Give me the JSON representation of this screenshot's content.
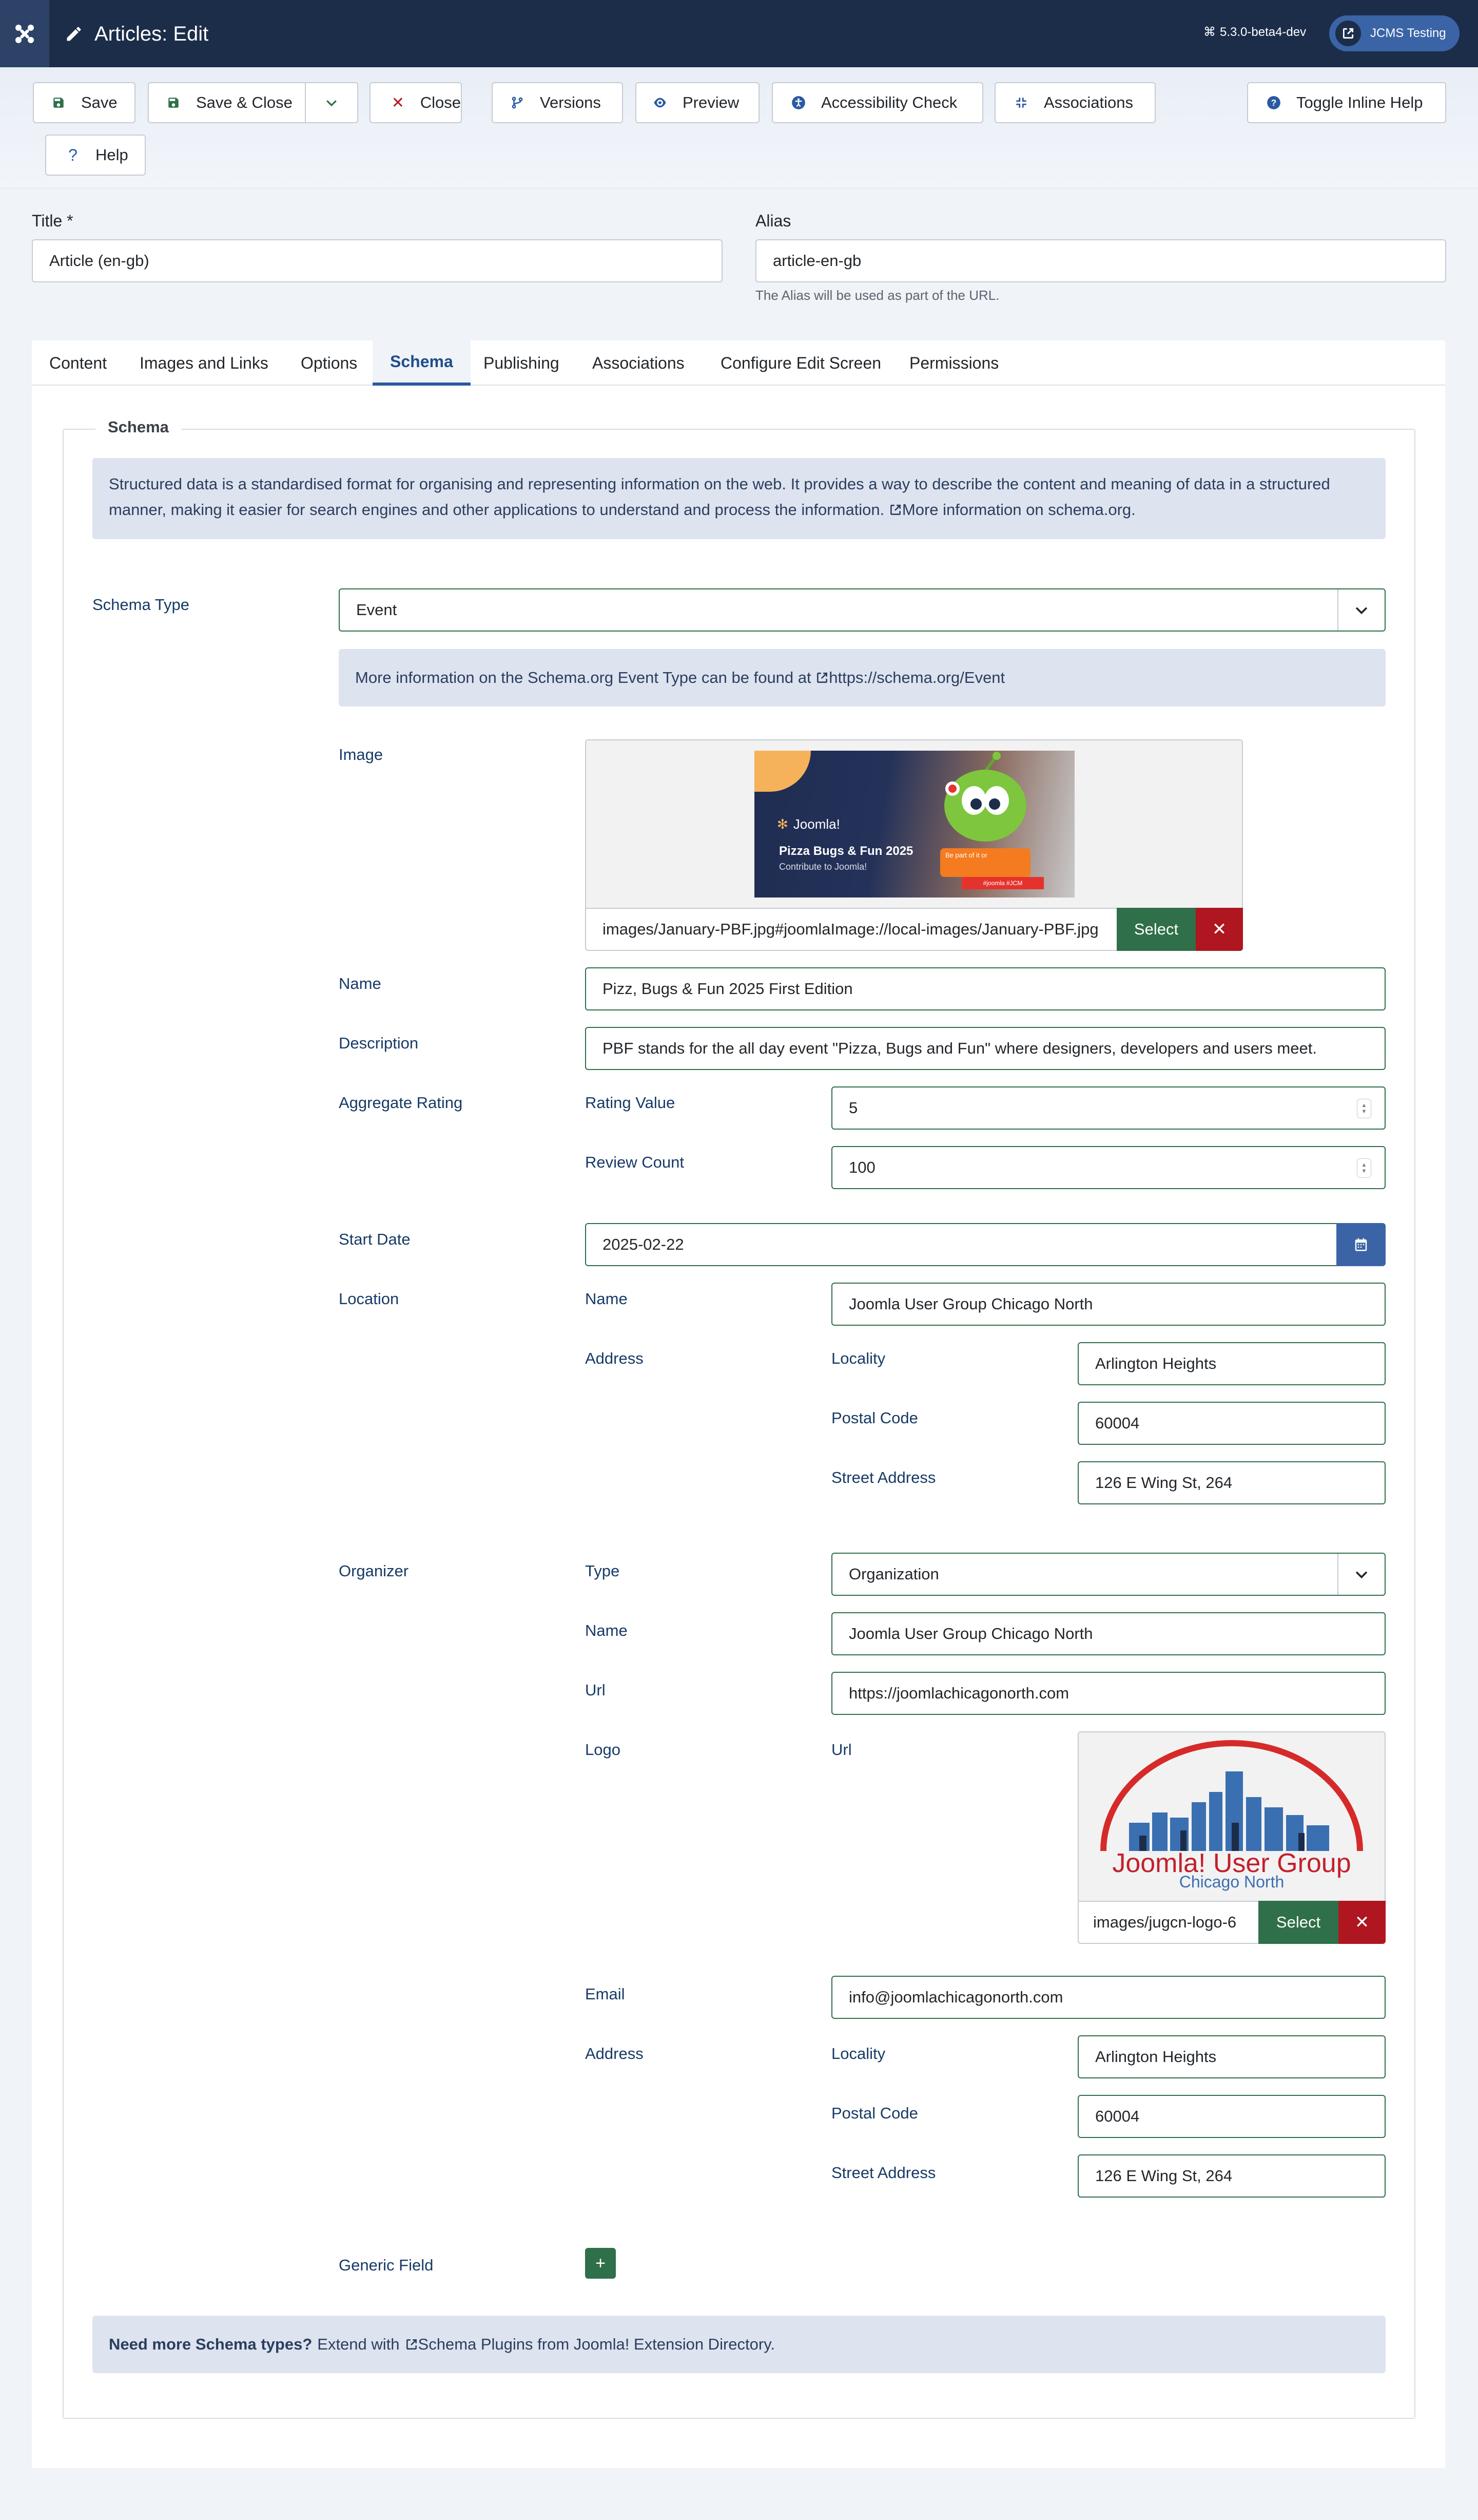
{
  "header": {
    "title": "Articles: Edit",
    "version": "5.3.0-beta4-dev",
    "site_button": "JCMS Testing"
  },
  "toolbar": {
    "save": "Save",
    "save_close": "Save & Close",
    "close": "Close",
    "versions": "Versions",
    "preview": "Preview",
    "accessibility": "Accessibility Check",
    "associations": "Associations",
    "toggle_help": "Toggle Inline Help",
    "help": "Help"
  },
  "article": {
    "title_label": "Title *",
    "title_value": "Article (en-gb)",
    "alias_label": "Alias",
    "alias_value": "article-en-gb",
    "alias_hint": "The Alias will be used as part of the URL."
  },
  "tabs": [
    "Content",
    "Images and Links",
    "Options",
    "Schema",
    "Publishing",
    "Associations",
    "Configure Edit Screen",
    "Permissions"
  ],
  "schema": {
    "legend": "Schema",
    "intro": "Structured data is a standardised format for organising and representing information on the web. It provides a way to describe the content and meaning of data in a structured manner, making it easier for search engines and other applications to understand and process the information.",
    "intro_link": "More information on schema.org.",
    "type_label": "Schema Type",
    "type_value": "Event",
    "type_info": "More information on the Schema.org Event Type can be found at",
    "type_info_link": "https://schema.org/Event",
    "image_label": "Image",
    "image_path": "images/January-PBF.jpg#joomlaImage://local-images/January-PBF.jpg",
    "image_banner": {
      "brand": "Joomla!",
      "headline": "Pizza Bugs & Fun 2025",
      "sub": "Contribute to Joomla!",
      "badge1": "Be part of it or",
      "badge2": "#joomla #JCM"
    },
    "select": "Select",
    "remove": "✕",
    "name_label": "Name",
    "name_value": "Pizz, Bugs & Fun 2025 First Edition",
    "desc_label": "Description",
    "desc_value": "PBF stands for the all day event \"Pizza, Bugs and Fun\" where designers, developers and users meet.",
    "rating_label": "Aggregate Rating",
    "rating_value_label": "Rating Value",
    "rating_value": "5",
    "review_count_label": "Review Count",
    "review_count": "100",
    "start_label": "Start Date",
    "start_value": "2025-02-22",
    "location_label": "Location",
    "loc_name_label": "Name",
    "loc_name": "Joomla User Group Chicago North",
    "address_label": "Address",
    "locality_label": "Locality",
    "locality": "Arlington Heights",
    "postal_label": "Postal Code",
    "postal": "60004",
    "street_label": "Street Address",
    "street": "126 E Wing St, 264",
    "organizer_label": "Organizer",
    "org_type_label": "Type",
    "org_type": "Organization",
    "org_name_label": "Name",
    "org_name": "Joomla User Group Chicago North",
    "org_url_label": "Url",
    "org_url": "https://joomlachicagonorth.com",
    "logo_label": "Logo",
    "logo_url_label": "Url",
    "logo_path": "images/jugcn-logo-6",
    "logo_text1": "Joomla! User Group",
    "logo_text2": "Chicago North",
    "email_label": "Email",
    "email": "info@joomlachicagonorth.com",
    "org_address_label": "Address",
    "org_locality_label": "Locality",
    "org_locality": "Arlington Heights",
    "org_postal_label": "Postal Code",
    "org_postal": "60004",
    "org_street_label": "Street Address",
    "org_street": "126 E Wing St, 264",
    "generic_label": "Generic Field",
    "generic_add": "+",
    "more_bold": "Need more Schema types?",
    "more_text": "Extend with",
    "more_link": "Schema Plugins from Joomla! Extension Directory."
  },
  "colors": {
    "header_bg": "#1c2d4a",
    "accent": "#2a5aa0",
    "success": "#2f6f49",
    "danger": "#b0161f"
  }
}
